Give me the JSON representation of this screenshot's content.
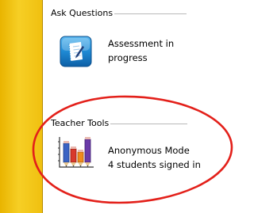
{
  "groups": {
    "ask_questions": {
      "title": "Ask Questions",
      "item": {
        "icon": "assessment-icon",
        "lines": [
          "Assessment in",
          "progress"
        ]
      }
    },
    "teacher_tools": {
      "title": "Teacher Tools",
      "item": {
        "icon": "pencils-chart-icon",
        "lines": [
          "Anonymous Mode",
          "4 students signed in"
        ]
      }
    }
  },
  "colors": {
    "sidebar": "#f6cf25",
    "highlight_ellipse": "#e3201a",
    "icon_blue": "#1f8ad4"
  }
}
